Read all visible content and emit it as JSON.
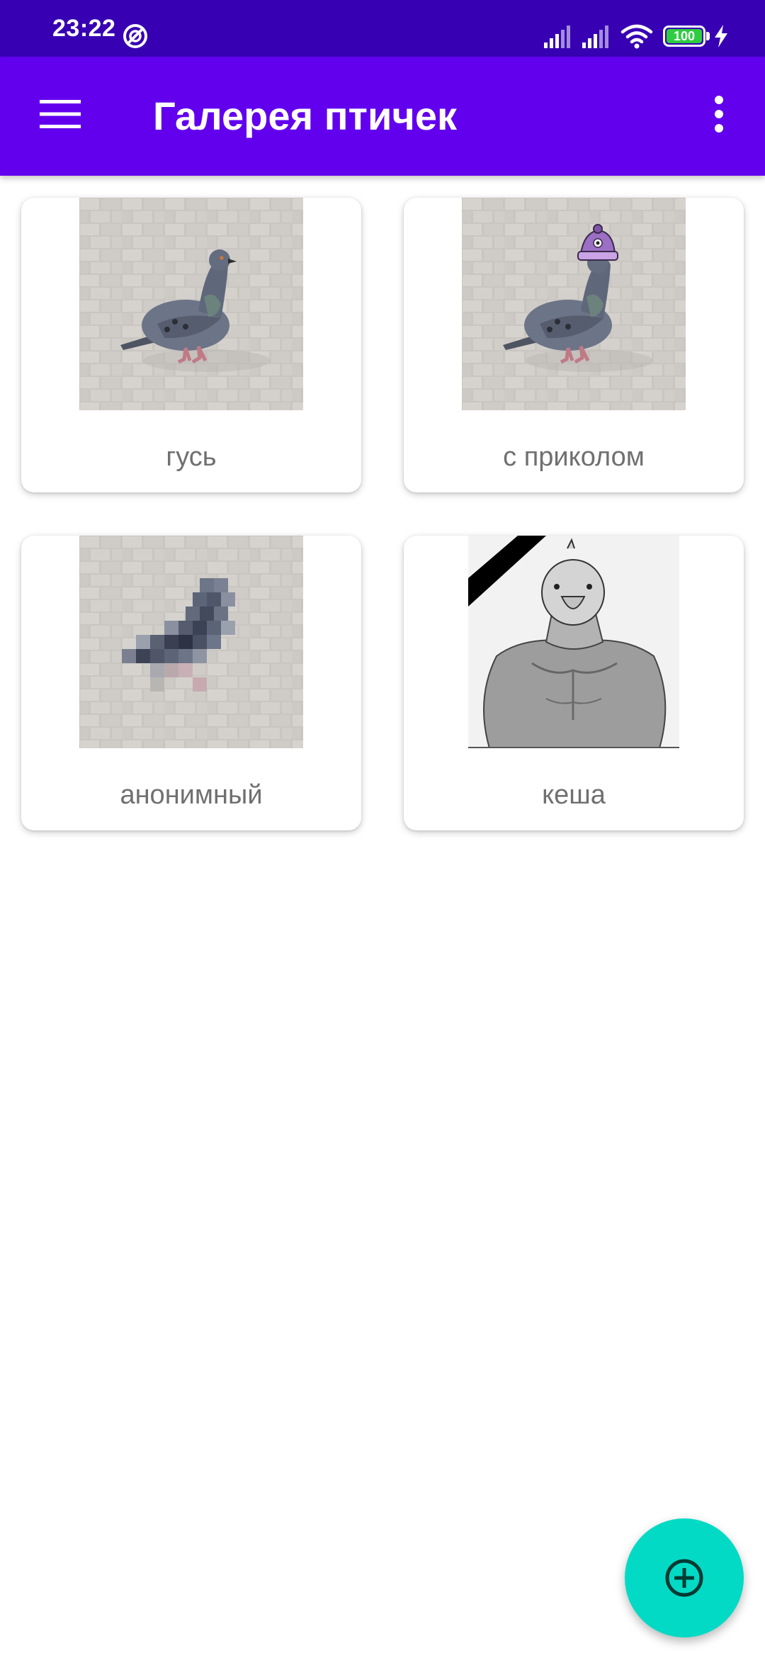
{
  "status_bar": {
    "time": "23:22",
    "battery": "100",
    "icons": [
      "do-not-disturb-icon",
      "signal-icon",
      "signal-icon",
      "wifi-icon",
      "battery-icon",
      "charging-icon"
    ]
  },
  "app_bar": {
    "title": "Галерея птичек",
    "menu_icon": "hamburger-menu-icon",
    "more_icon": "more-vert-icon",
    "color": "#6200ee",
    "status_color": "#3700b3"
  },
  "gallery": {
    "items": [
      {
        "label": "гусь",
        "image": "pigeon-photo"
      },
      {
        "label": "с приколом",
        "image": "pigeon-with-hat-photo"
      },
      {
        "label": "анонимный",
        "image": "pixelated-pigeon-photo"
      },
      {
        "label": "кеша",
        "image": "muscular-bird-mourning-photo"
      }
    ]
  },
  "fab": {
    "icon": "add-circle-icon",
    "color": "#03dac5"
  }
}
